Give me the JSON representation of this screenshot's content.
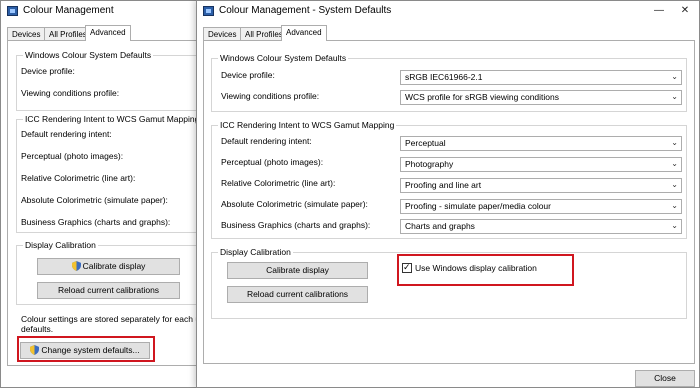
{
  "back_window": {
    "title": "Colour Management",
    "tabs": [
      "Devices",
      "All Profiles",
      "Advanced"
    ],
    "wcs_group": "Windows Colour System Defaults",
    "device_profile_label": "Device profile:",
    "viewing_label": "Viewing conditions profile:",
    "icc_group": "ICC Rendering Intent to WCS Gamut Mapping",
    "default_intent_label": "Default rendering intent:",
    "perceptual_label": "Perceptual (photo images):",
    "relative_label": "Relative Colorimetric (line art):",
    "absolute_label": "Absolute Colorimetric (simulate paper):",
    "business_label": "Business Graphics (charts and graphs):",
    "calib_group": "Display Calibration",
    "calibrate_btn": "Calibrate display",
    "reload_btn": "Reload current calibrations",
    "note_line1": "Colour settings are stored separately for each u",
    "note_line2": "defaults.",
    "change_defaults_btn": "Change system defaults..."
  },
  "front_window": {
    "title": "Colour Management - System Defaults",
    "tabs": [
      "Devices",
      "All Profiles",
      "Advanced"
    ],
    "wcs_group": "Windows Colour System Defaults",
    "device_profile_label": "Device profile:",
    "device_profile_value": "sRGB IEC61966-2.1",
    "viewing_label": "Viewing conditions profile:",
    "viewing_value": "WCS profile for sRGB viewing conditions",
    "icc_group": "ICC Rendering Intent to WCS Gamut Mapping",
    "default_intent_label": "Default rendering intent:",
    "default_intent_value": "Perceptual",
    "perceptual_label": "Perceptual (photo images):",
    "perceptual_value": "Photography",
    "relative_label": "Relative Colorimetric (line art):",
    "relative_value": "Proofing and line art",
    "absolute_label": "Absolute Colorimetric (simulate paper):",
    "absolute_value": "Proofing - simulate paper/media colour",
    "business_label": "Business Graphics (charts and graphs):",
    "business_value": "Charts and graphs",
    "calib_group": "Display Calibration",
    "calibrate_btn": "Calibrate display",
    "reload_btn": "Reload current calibrations",
    "use_calibration_label": "Use Windows display calibration",
    "use_calibration_checked": true,
    "close_btn": "Close"
  },
  "icons": {
    "window": "colour-management-icon",
    "shield": "uac-shield-icon",
    "dropdown": "chevron-down-icon",
    "minimize": "minimize-icon",
    "close": "close-icon"
  },
  "colors": {
    "highlight": "#d0161f",
    "accent": "#2c5fa8"
  }
}
